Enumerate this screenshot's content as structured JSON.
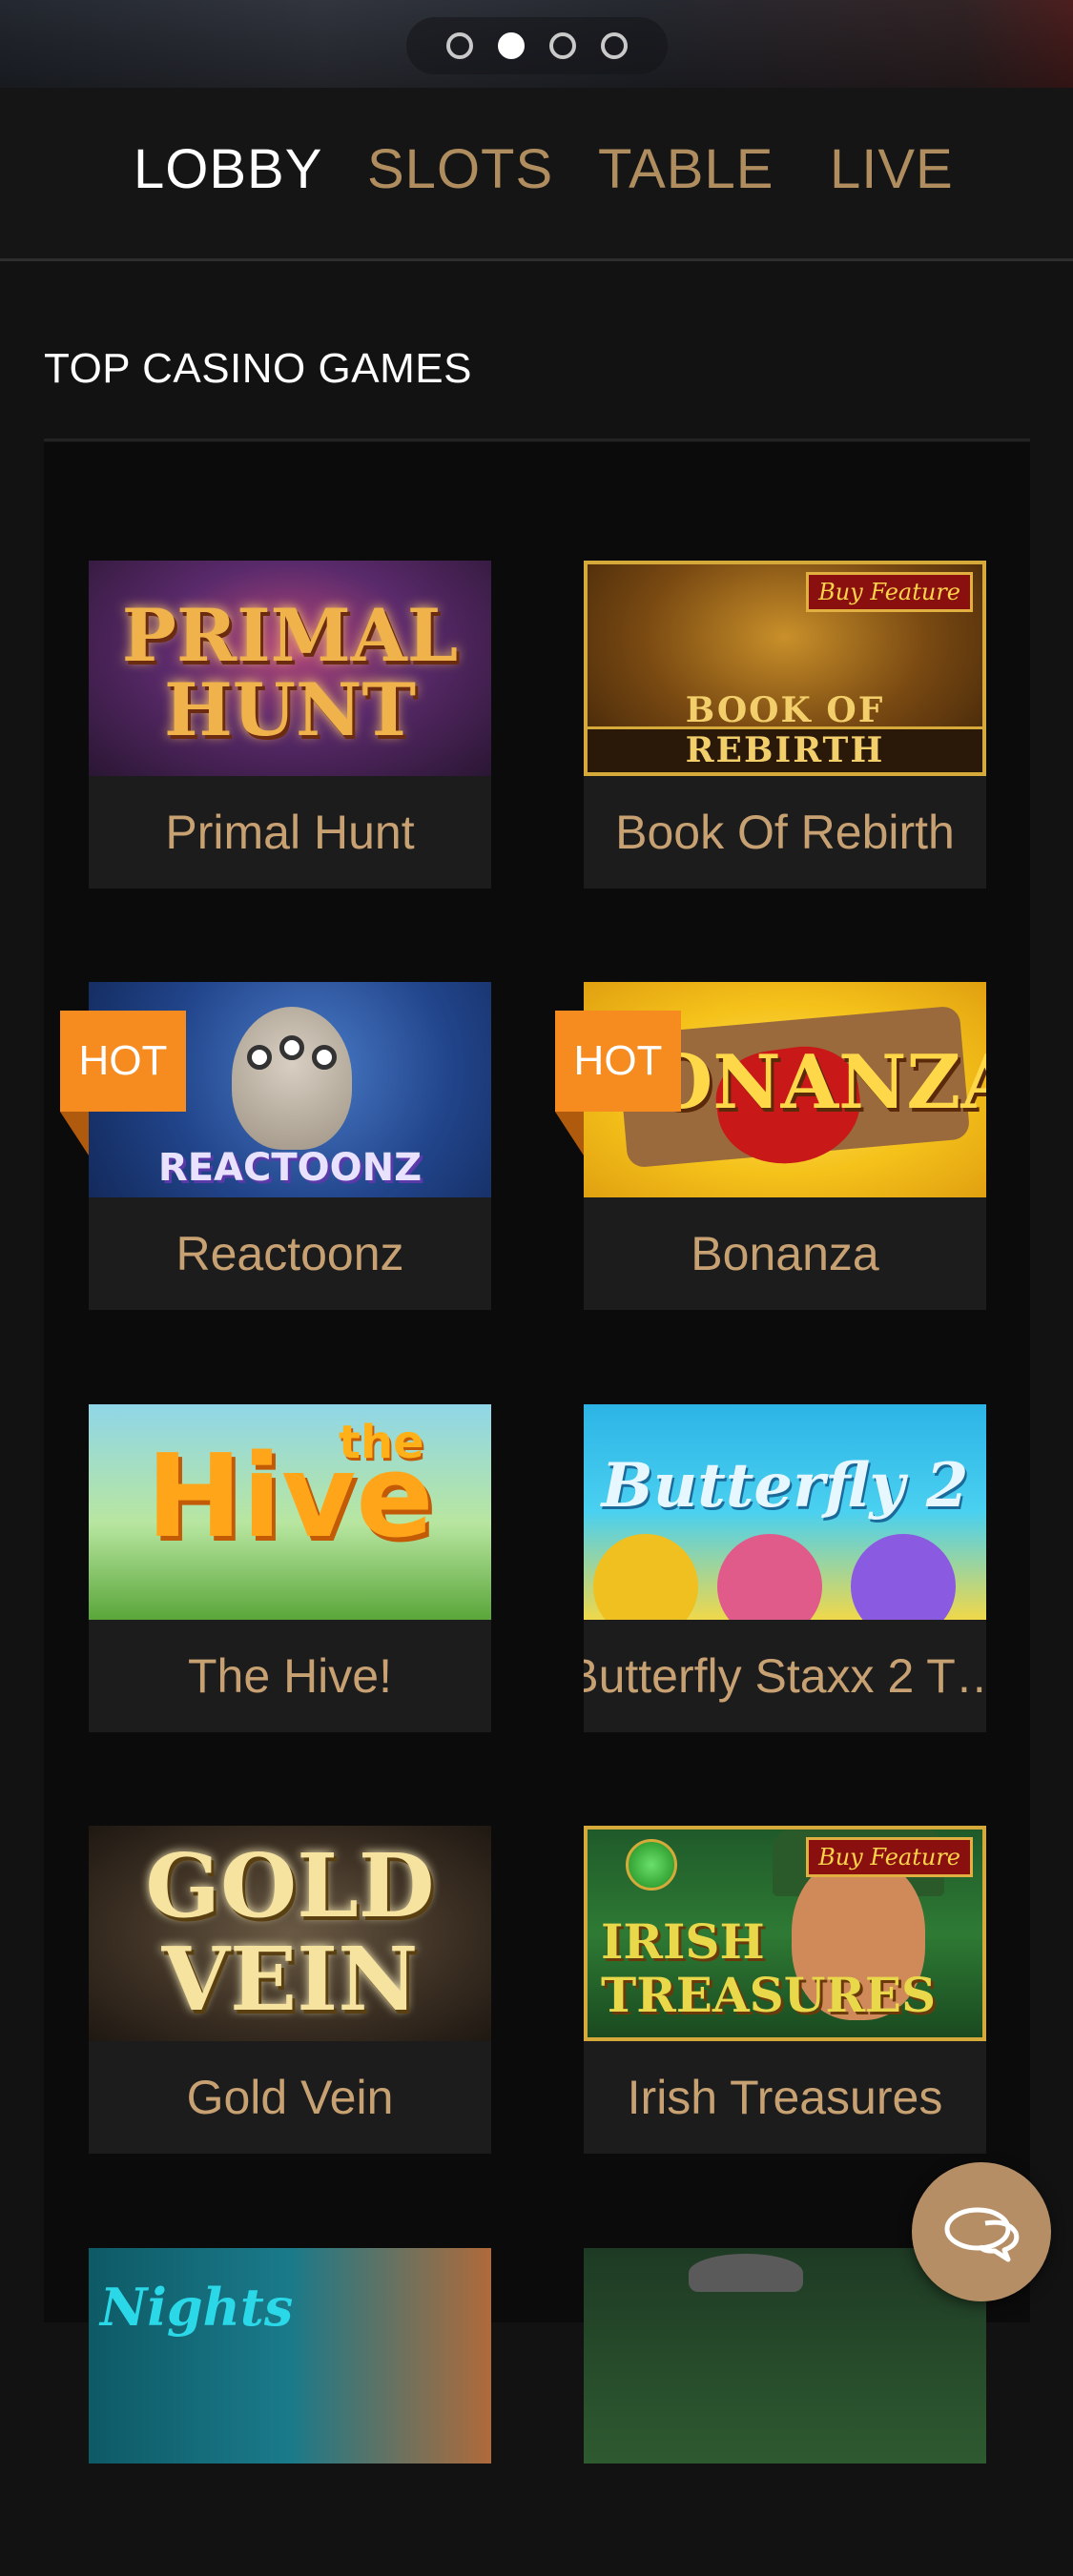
{
  "carousel": {
    "slide_count": 4,
    "active_index": 1
  },
  "tabs": [
    {
      "label": "LOBBY",
      "active": true
    },
    {
      "label": "SLOTS",
      "active": false
    },
    {
      "label": "TABLE",
      "active": false
    },
    {
      "label": "LIVE",
      "active": false
    }
  ],
  "section": {
    "title": "TOP CASINO GAMES"
  },
  "games": [
    {
      "name": "Primal Hunt",
      "art_text": "PRIMAL HUNT",
      "badge": ""
    },
    {
      "name": "Book Of Rebirth",
      "art_text": "BOOK OF REBIRTH",
      "art_badge": "Buy Feature",
      "badge": ""
    },
    {
      "name": "Reactoonz",
      "art_text": "REACTOONZ",
      "badge": "HOT"
    },
    {
      "name": "Bonanza",
      "art_text": "BONANZA",
      "badge": "HOT"
    },
    {
      "name": "The Hive!",
      "art_text": "Hive",
      "art_text_small": "the",
      "badge": ""
    },
    {
      "name": "Butterfly Staxx 2 T…",
      "art_text": "Butterfly 2",
      "badge": ""
    },
    {
      "name": "Gold Vein",
      "art_text": "GOLD VEIN",
      "badge": ""
    },
    {
      "name": "Irish Treasures",
      "art_text": "IRISH TREASURES",
      "art_badge": "Buy Feature",
      "badge": ""
    },
    {
      "name": "",
      "art_text": "Nights",
      "badge": ""
    },
    {
      "name": "",
      "art_text": "",
      "badge": ""
    }
  ],
  "colors": {
    "background": "#121212",
    "tab_active": "#ffffff",
    "tab_inactive": "#b08d5e",
    "card_label": "#c8a173",
    "hot_badge": "#f68b1f",
    "chat_button": "#b58e66"
  },
  "icons": {
    "chat": "chat-bubble-icon"
  }
}
